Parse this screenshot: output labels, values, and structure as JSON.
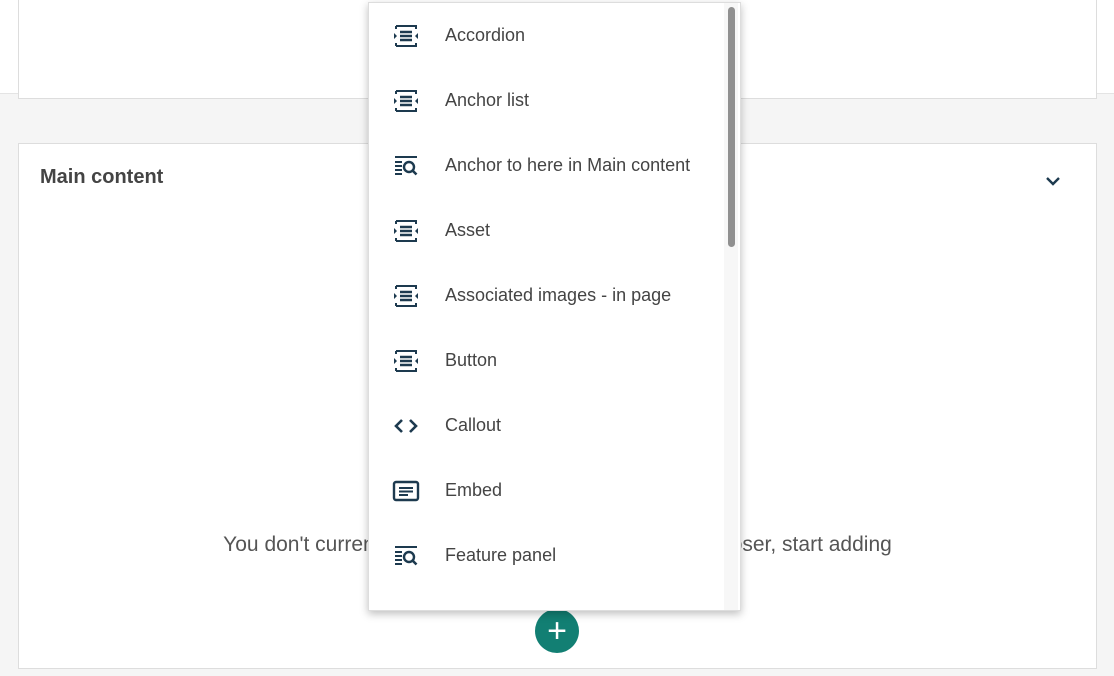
{
  "main_content": {
    "title": "Main content",
    "empty_message": "You don't currently have any blocks. Use the block chooser, start adding"
  },
  "menu": {
    "items": [
      {
        "label": "Accordion",
        "icon": "block-icon"
      },
      {
        "label": "Anchor list",
        "icon": "block-icon"
      },
      {
        "label": "Anchor to here in Main content",
        "icon": "search-list-icon"
      },
      {
        "label": "Asset",
        "icon": "block-icon"
      },
      {
        "label": "Associated images - in page",
        "icon": "block-icon"
      },
      {
        "label": "Button",
        "icon": "block-icon"
      },
      {
        "label": "Callout",
        "icon": "code-icon"
      },
      {
        "label": "Embed",
        "icon": "embed-icon"
      },
      {
        "label": "Feature panel",
        "icon": "search-list-icon"
      }
    ]
  },
  "colors": {
    "accent": "#127f73",
    "icon": "#1d3a4f"
  }
}
